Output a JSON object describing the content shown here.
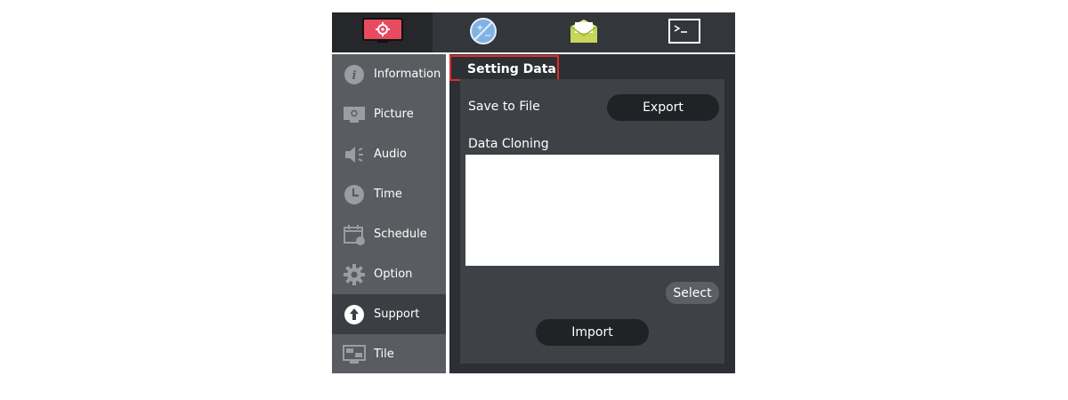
{
  "top_tabs": [
    {
      "name": "settings-monitor-icon"
    },
    {
      "name": "player-icon"
    },
    {
      "name": "mail-icon"
    },
    {
      "name": "terminal-icon"
    }
  ],
  "sidebar": {
    "items": [
      {
        "label": "Information",
        "icon": "info-icon"
      },
      {
        "label": "Picture",
        "icon": "picture-icon"
      },
      {
        "label": "Audio",
        "icon": "audio-icon"
      },
      {
        "label": "Time",
        "icon": "clock-icon"
      },
      {
        "label": "Schedule",
        "icon": "calendar-icon"
      },
      {
        "label": "Option",
        "icon": "gear-icon"
      },
      {
        "label": "Support",
        "icon": "upload-icon"
      },
      {
        "label": "Tile",
        "icon": "tile-icon"
      }
    ],
    "active_index": 6
  },
  "panel": {
    "title": "Setting Data",
    "save_to_file_label": "Save to File",
    "export_label": "Export",
    "data_cloning_label": "Data Cloning",
    "select_label": "Select",
    "import_label": "Import"
  },
  "colors": {
    "accent_red": "#e84a5f",
    "highlight_border": "#e32b2b",
    "sidebar_bg": "#595c60",
    "content_bg": "#2c2f33"
  }
}
